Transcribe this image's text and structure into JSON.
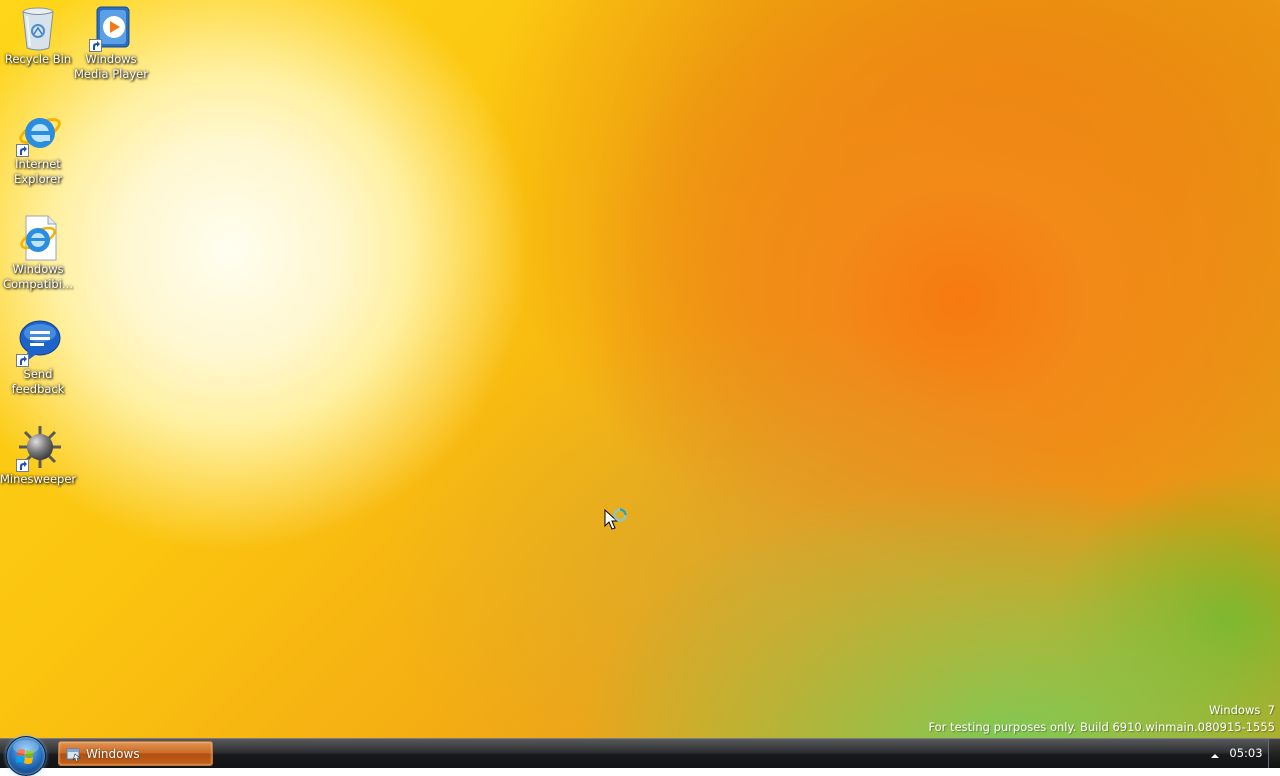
{
  "desktop": {
    "icons": [
      {
        "label": "Recycle Bin",
        "icon": "recycle-bin-icon"
      },
      {
        "label": "Windows Media Player",
        "icon": "windows-media-player-icon"
      },
      {
        "label": "Internet Explorer",
        "icon": "internet-explorer-icon"
      },
      {
        "label": "Windows Compatibi...",
        "icon": "internet-explorer-document-icon"
      },
      {
        "label": "Send feedback",
        "icon": "feedback-speech-bubble-icon"
      },
      {
        "label": "Minesweeper",
        "icon": "mine-icon"
      }
    ]
  },
  "watermark": {
    "line1": "Windows  7",
    "line2": "For testing purposes only. Build 6910.winmain.080915-1555"
  },
  "taskbar": {
    "start_icon": "windows-logo-icon",
    "task_button_label": "Windows",
    "task_button_icon": "explorer-window-icon",
    "clock": "05:03"
  },
  "colors": {
    "taskbar_active": "#c9651f",
    "wallpaper_yellow": "#ffd61a",
    "wallpaper_orange": "#f67a10",
    "wallpaper_green": "#7acb55"
  }
}
